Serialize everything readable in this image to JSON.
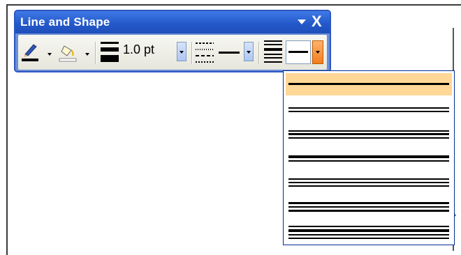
{
  "toolbar": {
    "title": "Line and Shape",
    "close_glyph": "X",
    "buttons": [
      {
        "name": "line-color-icon"
      },
      {
        "name": "fill-color-icon"
      },
      {
        "name": "line-weight-icon"
      },
      {
        "name": "dash-style-icon"
      },
      {
        "name": "line-style-icon"
      }
    ],
    "line_weight_value": "1.0 pt"
  },
  "line_style_menu": {
    "items": [
      {
        "style": "single-thick",
        "selected": true
      },
      {
        "style": "double-thin"
      },
      {
        "style": "thin-thick-thin"
      },
      {
        "style": "thick-thin"
      },
      {
        "style": "triple-thin"
      },
      {
        "style": "thick-thin-thick"
      },
      {
        "style": "thin-thick-thin-heavy"
      }
    ]
  },
  "colors": {
    "title_bar": "#2357c9",
    "selected_item": "#ffd797",
    "menu_border": "#002d96"
  }
}
